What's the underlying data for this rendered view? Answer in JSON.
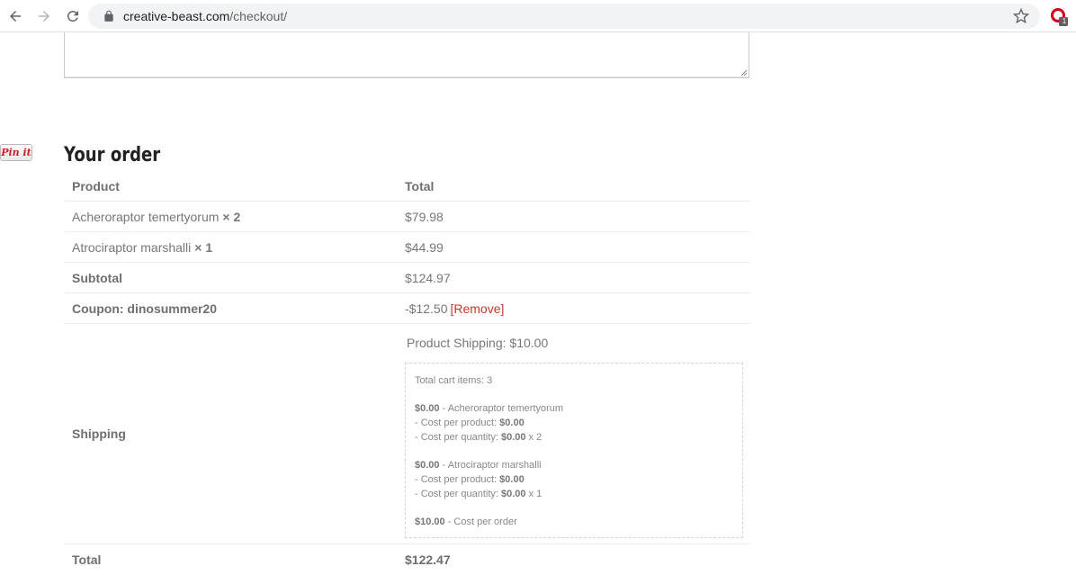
{
  "browser": {
    "url_domain": "creative-beast.com",
    "url_path": "/checkout/",
    "extension_badge": "1"
  },
  "pinit": {
    "label": "Pin it"
  },
  "order": {
    "heading": "Your order",
    "headers": {
      "product": "Product",
      "total": "Total"
    },
    "items": [
      {
        "name": "Acheroraptor temertyorum",
        "qty": "× 2",
        "total": "$79.98"
      },
      {
        "name": "Atrociraptor marshalli",
        "qty": "× 1",
        "total": "$44.99"
      }
    ],
    "subtotal": {
      "label": "Subtotal",
      "value": "$124.97"
    },
    "coupon": {
      "label": "Coupon: dinosummer20",
      "value": "-$12.50",
      "remove": "[Remove]"
    },
    "shipping": {
      "label": "Shipping",
      "method": "Product Shipping: $10.00",
      "details": {
        "total_items": "Total cart items: 3",
        "item1": {
          "price": "$0.00",
          "name": " - Acheroraptor temertyorum",
          "per_product_label": "- Cost per product: ",
          "per_product_value": "$0.00",
          "per_qty_label": "- Cost per quantity: ",
          "per_qty_value": "$0.00",
          "per_qty_mult": " x 2"
        },
        "item2": {
          "price": "$0.00",
          "name": " - Atrociraptor marshalli",
          "per_product_label": "- Cost per product: ",
          "per_product_value": "$0.00",
          "per_qty_label": "- Cost per quantity: ",
          "per_qty_value": "$0.00",
          "per_qty_mult": " x 1"
        },
        "per_order": {
          "price": "$10.00",
          "label": " - Cost per order"
        }
      }
    },
    "total": {
      "label": "Total",
      "value": "$122.47"
    }
  }
}
